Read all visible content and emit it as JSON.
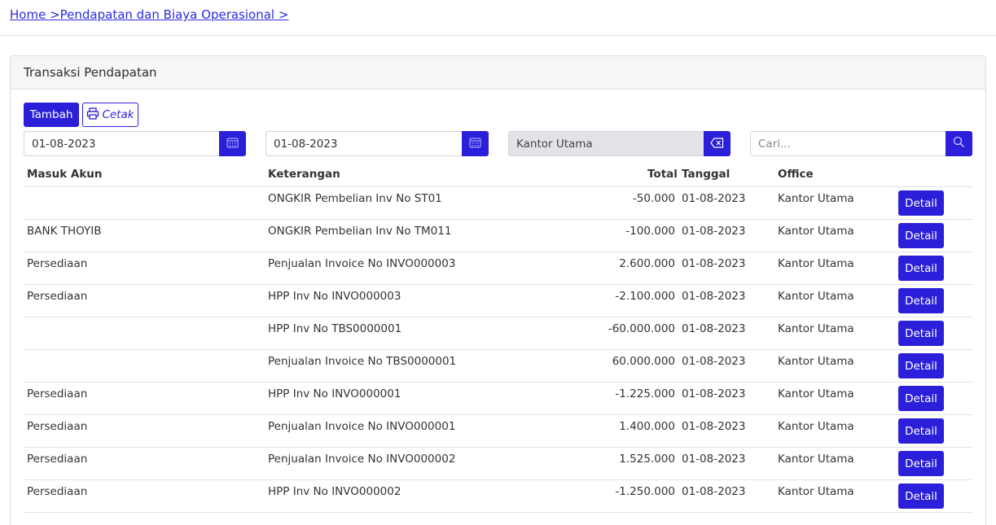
{
  "breadcrumb": {
    "home": "Home >",
    "section": "Pendapatan dan Biaya Operasional >"
  },
  "card": {
    "title": "Transaksi Pendapatan"
  },
  "toolbar": {
    "add_label": "Tambah",
    "print_label": "Cetak"
  },
  "filters": {
    "date_from": "01-08-2023",
    "date_to": "01-08-2023",
    "office": "Kantor Utama",
    "search_placeholder": "Cari..."
  },
  "table": {
    "headers": {
      "akun": "Masuk Akun",
      "keterangan": "Keterangan",
      "total": "Total",
      "tanggal": "Tanggal",
      "office": "Office"
    },
    "detail_label": "Detail",
    "rows": [
      {
        "akun": "",
        "keterangan": "ONGKIR Pembelian Inv No ST01",
        "total": "-50.000",
        "tanggal": "01-08-2023",
        "office": "Kantor Utama"
      },
      {
        "akun": "BANK THOYIB",
        "keterangan": "ONGKIR Pembelian Inv No TM011",
        "total": "-100.000",
        "tanggal": "01-08-2023",
        "office": "Kantor Utama"
      },
      {
        "akun": "Persediaan",
        "keterangan": "Penjualan Invoice No INVO000003",
        "total": "2.600.000",
        "tanggal": "01-08-2023",
        "office": "Kantor Utama"
      },
      {
        "akun": "Persediaan",
        "keterangan": "HPP Inv No INVO000003",
        "total": "-2.100.000",
        "tanggal": "01-08-2023",
        "office": "Kantor Utama"
      },
      {
        "akun": "",
        "keterangan": "HPP Inv No TBS0000001",
        "total": "-60.000.000",
        "tanggal": "01-08-2023",
        "office": "Kantor Utama"
      },
      {
        "akun": "",
        "keterangan": "Penjualan Invoice No TBS0000001",
        "total": "60.000.000",
        "tanggal": "01-08-2023",
        "office": "Kantor Utama"
      },
      {
        "akun": "Persediaan",
        "keterangan": "HPP Inv No INVO000001",
        "total": "-1.225.000",
        "tanggal": "01-08-2023",
        "office": "Kantor Utama"
      },
      {
        "akun": "Persediaan",
        "keterangan": "Penjualan Invoice No INVO000001",
        "total": "1.400.000",
        "tanggal": "01-08-2023",
        "office": "Kantor Utama"
      },
      {
        "akun": "Persediaan",
        "keterangan": "Penjualan Invoice No INVO000002",
        "total": "1.525.000",
        "tanggal": "01-08-2023",
        "office": "Kantor Utama"
      },
      {
        "akun": "Persediaan",
        "keterangan": "HPP Inv No INVO000002",
        "total": "-1.250.000",
        "tanggal": "01-08-2023",
        "office": "Kantor Utama"
      }
    ]
  },
  "icons": {
    "calendar": "calendar-icon",
    "clear": "backspace-icon",
    "search": "search-icon",
    "print": "printer-icon"
  },
  "colors": {
    "primary": "#2b1fd9",
    "link": "#2b2be0"
  }
}
